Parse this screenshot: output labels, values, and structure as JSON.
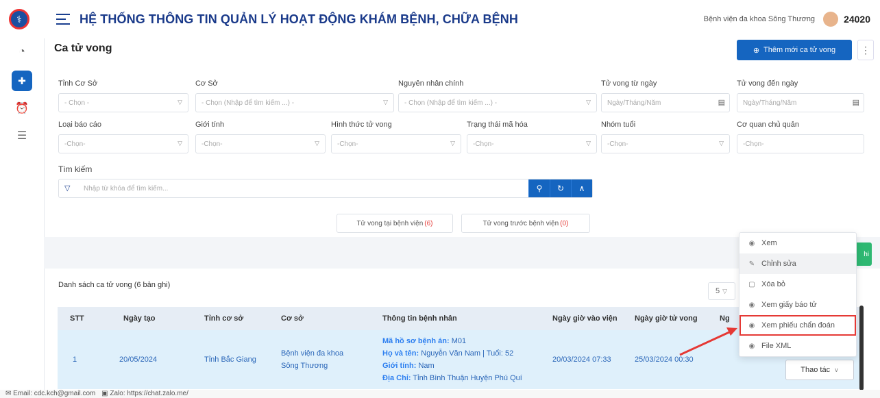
{
  "header": {
    "title": "HỆ THỐNG THÔNG TIN QUẢN LÝ HOẠT ĐỘNG KHÁM BỆNH, CHỮA BỆNH",
    "hospital": "Bệnh viện đa khoa Sông Thương",
    "user_id": "24020"
  },
  "page": {
    "title": "Ca tử vong",
    "add_button": "Thêm mới ca tử vong"
  },
  "filters": {
    "tinh_co_so": {
      "label": "Tỉnh Cơ Sở",
      "placeholder": "- Chọn -"
    },
    "co_so": {
      "label": "Cơ Sở",
      "placeholder": "- Chọn (Nhập để tìm kiếm ...) -"
    },
    "nguyen_nhan": {
      "label": "Nguyên nhân chính",
      "placeholder": "- Chọn (Nhập để tìm kiếm ...) -"
    },
    "tu_ngay": {
      "label": "Tử vong từ ngày",
      "placeholder": "Ngày/Tháng/Năm"
    },
    "den_ngay": {
      "label": "Tử vong đến ngày",
      "placeholder": "Ngày/Tháng/Năm"
    },
    "loai_bao_cao": {
      "label": "Loại báo cáo",
      "placeholder": "-Chọn-"
    },
    "gioi_tinh": {
      "label": "Giới tính",
      "placeholder": "-Chọn-"
    },
    "hinh_thuc": {
      "label": "Hình thức tử vong",
      "placeholder": "-Chọn-"
    },
    "trang_thai": {
      "label": "Trạng thái mã hóa",
      "placeholder": "-Chọn-"
    },
    "nhom_tuoi": {
      "label": "Nhóm tuổi",
      "placeholder": "-Chọn-"
    },
    "co_quan": {
      "label": "Cơ quan chủ quản",
      "placeholder": "-Chọn-"
    }
  },
  "search": {
    "label": "Tìm kiếm",
    "placeholder": "Nhập từ khóa để tìm kiếm..."
  },
  "chips": {
    "tai_bv_label": "Tử vong tại bệnh viện",
    "tai_bv_count": "(6)",
    "truoc_bv_label": "Tử vong trước bệnh viện",
    "truoc_bv_count": "(0)"
  },
  "list": {
    "title": "Danh sách ca tử vong (6 bản ghi)",
    "page_size": "5",
    "columns": [
      "STT",
      "Ngày tạo",
      "Tỉnh cơ sở",
      "Cơ sở",
      "Thông tin bệnh nhân",
      "Ngày giờ vào viện",
      "Ngày giờ tử vong",
      "Ng"
    ],
    "rows": [
      {
        "stt": "1",
        "ngay_tao": "20/05/2024",
        "tinh": "Tỉnh Bắc Giang",
        "co_so": "Bệnh viện đa khoa Sông Thương",
        "ma_hs_label": "Mã hồ sơ bệnh án:",
        "ma_hs": "M01",
        "ho_ten_label": "Họ và tên:",
        "ho_ten": "Nguyễn Văn Nam | Tuổi: 52",
        "gioi_tinh_label": "Giới tính:",
        "gioi_tinh": "Nam",
        "dia_chi_label": "Địa Chỉ:",
        "dia_chi": "Tỉnh Bình Thuận Huyện Phú Quí",
        "vao_vien": "20/03/2024 07:33",
        "tu_vong": "25/03/2024 00:30"
      }
    ],
    "action_button": "Thao tác"
  },
  "menu": {
    "items": [
      {
        "label": "Xem",
        "icon": "eye-icon"
      },
      {
        "label": "Chỉnh sửa",
        "icon": "pencil-icon"
      },
      {
        "label": "Xóa bỏ",
        "icon": "trash-icon"
      },
      {
        "label": "Xem giấy báo tử",
        "icon": "eye-icon"
      },
      {
        "label": "Xem phiếu chẩn đoán",
        "icon": "eye-icon"
      },
      {
        "label": "File XML",
        "icon": "eye-icon"
      }
    ]
  },
  "footer": {
    "email": "Email: cdc.kch@gmail.com",
    "zalo": "Zalo: https://chat.zalo.me/"
  },
  "colors": {
    "primary": "#1565c0",
    "title": "#1a3a8a",
    "highlight": "#e53935",
    "success": "#2eb872"
  }
}
